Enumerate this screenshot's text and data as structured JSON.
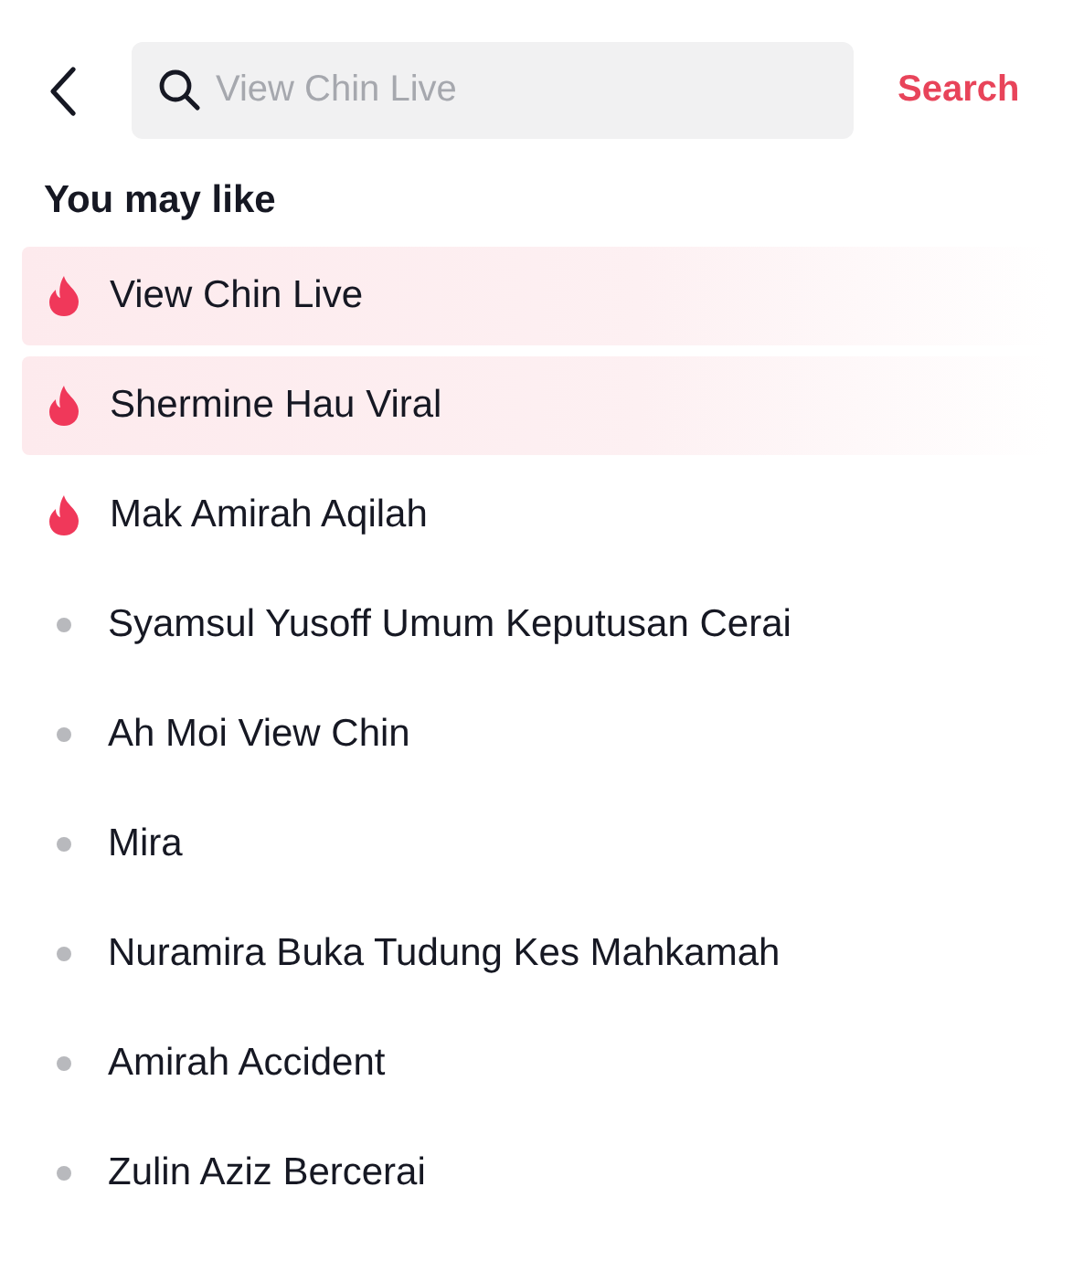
{
  "search": {
    "placeholder": "View Chin Live",
    "button": "Search"
  },
  "section_title": "You may like",
  "suggestions": [
    {
      "label": "View Chin Live",
      "kind": "trending",
      "highlighted": true
    },
    {
      "label": "Shermine Hau Viral",
      "kind": "trending",
      "highlighted": true
    },
    {
      "label": "Mak Amirah Aqilah",
      "kind": "trending",
      "highlighted": false
    },
    {
      "label": "Syamsul Yusoff Umum Keputusan Cerai",
      "kind": "plain",
      "highlighted": false
    },
    {
      "label": "Ah Moi View Chin",
      "kind": "plain",
      "highlighted": false
    },
    {
      "label": "Mira",
      "kind": "plain",
      "highlighted": false
    },
    {
      "label": "Nuramira Buka Tudung Kes Mahkamah",
      "kind": "plain",
      "highlighted": false
    },
    {
      "label": "Amirah Accident",
      "kind": "plain",
      "highlighted": false
    },
    {
      "label": "Zulin Aziz Bercerai",
      "kind": "plain",
      "highlighted": false
    }
  ]
}
